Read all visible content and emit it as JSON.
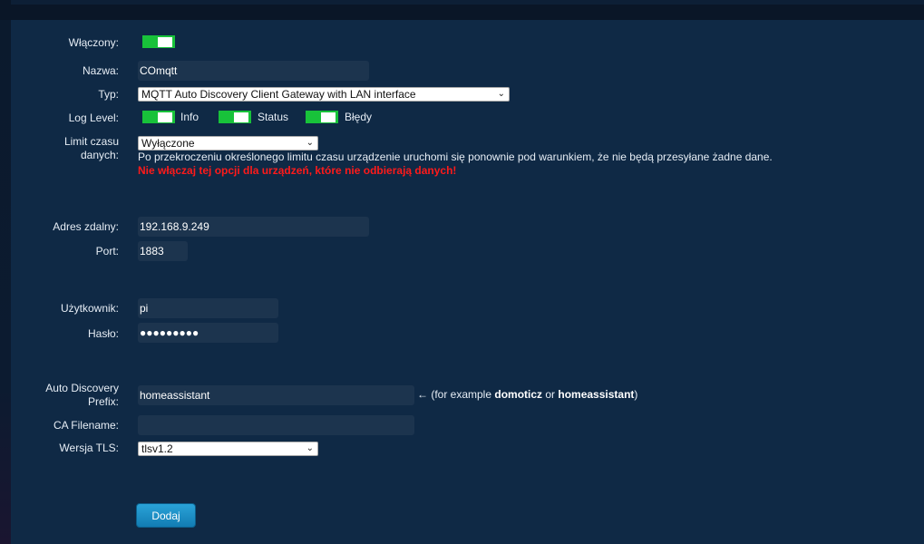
{
  "form": {
    "enabled_label": "Włączony:",
    "name_label": "Nazwa:",
    "name_value": "COmqtt",
    "type_label": "Typ:",
    "type_value": "MQTT Auto Discovery Client Gateway with LAN interface",
    "loglevel_label": "Log Level:",
    "loglevel_info": "Info",
    "loglevel_status": "Status",
    "loglevel_errors": "Błędy",
    "timeout_label_1": "Limit czasu",
    "timeout_label_2": "danych:",
    "timeout_value": "Wyłączone",
    "timeout_note": "Po przekroczeniu określonego limitu czasu urządzenie uruchomi się ponownie pod warunkiem, że nie będą przesyłane żadne dane.",
    "timeout_warning": "Nie włączaj tej opcji dla urządzeń, które nie odbierają danych!",
    "address_label": "Adres zdalny:",
    "address_value": "192.168.9.249",
    "port_label": "Port:",
    "port_value": "1883",
    "user_label": "Użytkownik:",
    "user_value": "pi",
    "password_label": "Hasło:",
    "password_value": "●●●●●●●●●",
    "prefix_label_1": "Auto Discovery",
    "prefix_label_2": "Prefix:",
    "prefix_value": "homeassistant",
    "prefix_hint_pre": "← (for example ",
    "prefix_hint_b1": "domoticz",
    "prefix_hint_mid": " or ",
    "prefix_hint_b2": "homeassistant",
    "prefix_hint_post": ")",
    "ca_label": "CA Filename:",
    "ca_value": "",
    "tls_label": "Wersja TLS:",
    "tls_value": "tlsv1.2",
    "add_button": "Dodaj"
  },
  "colors": {
    "background": "#0b1a2d",
    "panel": "#0f2945",
    "input": "#1c344e",
    "toggle_on": "#18c23a",
    "warning": "#ff1a1a",
    "button": "#1b8cc4"
  },
  "icons": {
    "select_arrow": "chevron-down-icon"
  }
}
